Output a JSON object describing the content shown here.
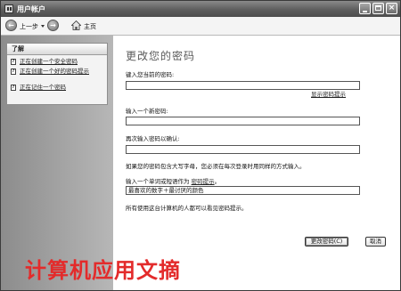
{
  "window": {
    "title": "用户帐户",
    "buttons": {
      "minimize": "",
      "maximize": "",
      "close": "×"
    }
  },
  "toolbar": {
    "back_label": "上一步",
    "home_label": "主页"
  },
  "sidebar": {
    "panel_title": "了解",
    "items": [
      {
        "label": "正在创建一个安全密码"
      },
      {
        "label": "正在创建一个好的密码提示"
      },
      {
        "label": "正在记住一个密码"
      }
    ]
  },
  "main": {
    "heading": "更改您的密码",
    "current_password_label": "键入您当前的密码:",
    "current_password_value": "",
    "show_hint_link": "显示密码提示",
    "new_password_label": "输入一个新密码:",
    "new_password_value": "",
    "confirm_password_label": "再次输入密码以确认:",
    "confirm_password_value": "",
    "caps_note": "如果您的密码包含大写字母，您必须在每次登录时用同样的方式输入。",
    "hint_label_prefix": "输入一个单词或短语作为",
    "hint_label_link": "密码提示",
    "hint_label_suffix": "。",
    "hint_value": "最喜欢的数字＋最讨厌的颜色",
    "visibility_note": "所有使用这台计算机的人都可以看见密码提示。",
    "change_button": "更改密码(C)",
    "cancel_button": "取消"
  },
  "watermark": "计算机应用文摘"
}
